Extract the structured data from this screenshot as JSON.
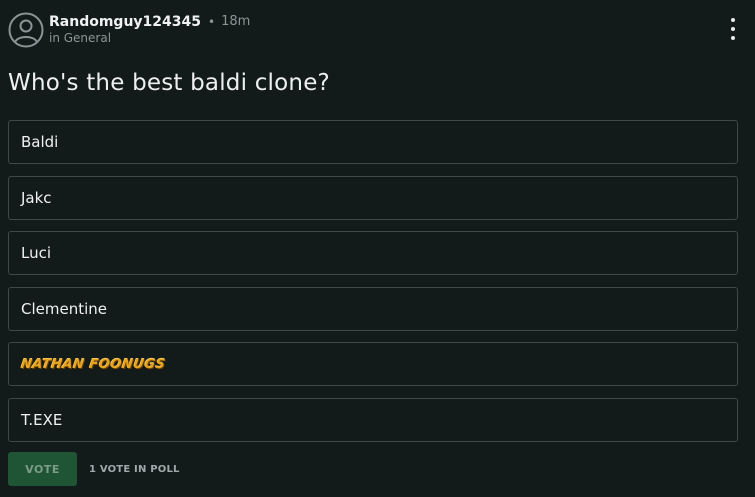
{
  "post": {
    "author": "Randomguy124345",
    "separator": "•",
    "time": "18m",
    "community": "in General",
    "title": "Who's the best baldi clone?"
  },
  "poll": {
    "options": [
      {
        "label": "Baldi"
      },
      {
        "label": "Jakc"
      },
      {
        "label": "Luci"
      },
      {
        "label": "Clementine"
      },
      {
        "label": "NATHAN FOONUGS",
        "style": "stylized-logo-text"
      },
      {
        "label": "T.EXE"
      }
    ],
    "vote_button": "VOTE",
    "vote_count": "1 VOTE IN POLL"
  },
  "icons": {
    "avatar": "user-circle-icon",
    "menu": "more-vertical-icon"
  },
  "colors": {
    "background": "#131a1a",
    "option_border": "#3e4848",
    "vote_button_bg": "#1f5435",
    "muted_text": "#8b9595",
    "fancy_text": "#e8a41c"
  }
}
